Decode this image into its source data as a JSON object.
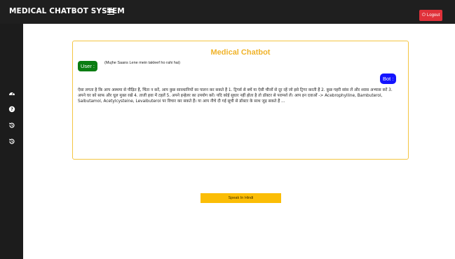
{
  "header": {
    "title": "MEDICAL CHATBOT SYSTEM",
    "logout_label": "Logout"
  },
  "sidebar": {
    "items": [
      {
        "icon": "dashboard-icon"
      },
      {
        "icon": "help-icon"
      },
      {
        "icon": "history-icon"
      },
      {
        "icon": "history-icon"
      }
    ]
  },
  "chat": {
    "title": "Medical Chatbot",
    "user_label": "User :",
    "user_message": "(Mujhe Saans Lene mein takleef ho rahi hai)",
    "bot_label": "Bot :",
    "bot_message": "ऐसा लगता है कि आप अस्थमा से पीड़ित हैं, चिंता न करें, आप कुछ सावधानियों का पालन कर सकते हैं 1. ट्रिगर्स से बचें या ऐसी चीजों से दूर रहें जो इसे ट्रिगर करती हैं 2. कुछ गहरी सांस लें और श्वास अभ्यास करें 3. अपने घर को साफ और धूल मुक्त रखें 4. ताजी हवा में टहलें 5. अपने इन्हेलर का उपयोग करें। यदि कोई सुधार नहीं होता है तो डॉक्टर से परामर्श लें। आप इन दवाओं -> Acebrophylline, Bambuterol, Salbutamol, Acetylcysteine, Levalbuterol पर विचार कर सकते हैं। या आप नीचे दी गई सूची से डॉक्टर के साथ जुड़ सकते हैं ..."
  },
  "actions": {
    "speak_label": "Speak In Hindi"
  },
  "colors": {
    "topbar": "#1f1f1f",
    "sidebar": "#1c1c1c",
    "logout": "#e0313a",
    "accent_title": "#f0b32a",
    "user_badge": "#0a7d12",
    "bot_badge": "#1414ff",
    "speak_button": "#fbbd06"
  }
}
